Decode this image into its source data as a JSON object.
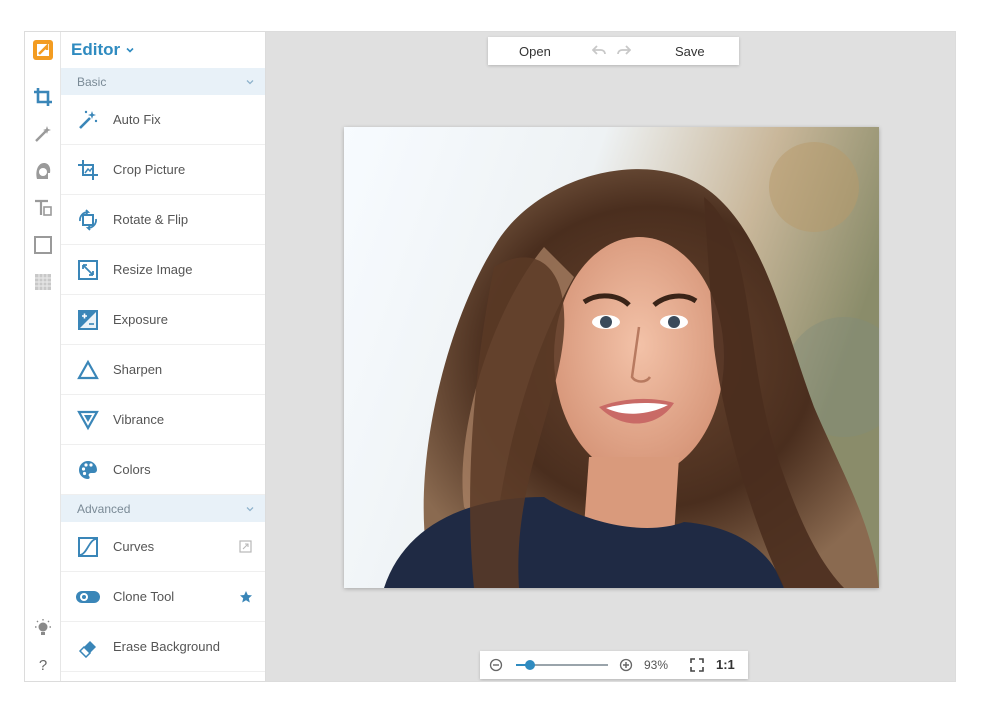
{
  "colors": {
    "accent": "#2f8bc0",
    "logo": "#f39c21",
    "icon": "#3a86b8",
    "rail_icon": "#9a9a9a"
  },
  "rail": {
    "items": [
      "logo-icon",
      "crop-icon",
      "magic-wand-icon",
      "face-retouch-icon",
      "text-icon",
      "frame-icon",
      "texture-icon",
      "brightness-icon"
    ],
    "help_label": "?"
  },
  "panel": {
    "title": "Editor",
    "sections": [
      {
        "label": "Basic",
        "tools": [
          "Auto Fix",
          "Crop Picture",
          "Rotate & Flip",
          "Resize Image",
          "Exposure",
          "Sharpen",
          "Vibrance",
          "Colors"
        ]
      },
      {
        "label": "Advanced",
        "tools": [
          "Curves",
          "Clone Tool",
          "Erase Background"
        ]
      }
    ]
  },
  "toolbar": {
    "open_label": "Open",
    "save_label": "Save"
  },
  "zoom": {
    "percent_label": "93%",
    "actual_size_label": "1:1",
    "slider_fraction": 0.15
  }
}
